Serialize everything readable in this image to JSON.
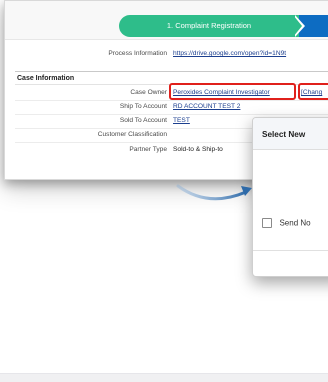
{
  "path": {
    "active_step": "1. Complaint Registration"
  },
  "process": {
    "label": "Process Information",
    "value": "https://drive.google.com/open?id=1N9t"
  },
  "case_info": {
    "section_title": "Case Information",
    "fields": [
      {
        "label": "Case Owner",
        "value": "Peroxides Complaint Investigator"
      },
      {
        "label": "Ship To Account",
        "value": "RD ACCOUNT TEST 2"
      },
      {
        "label": "Sold To Account",
        "value": "TEST"
      },
      {
        "label": "Customer Classification",
        "value": ""
      },
      {
        "label": "Partner Type",
        "value": "Sold-to & Ship-to"
      }
    ],
    "change_link": "[Chang"
  },
  "modal": {
    "title": "Select New",
    "checkbox_label": "Send No"
  },
  "colors": {
    "path_active": "#2ebd8a",
    "path_next": "#0d6cc2",
    "highlight": "#e0201b",
    "arrow": "#2e6aa8"
  }
}
